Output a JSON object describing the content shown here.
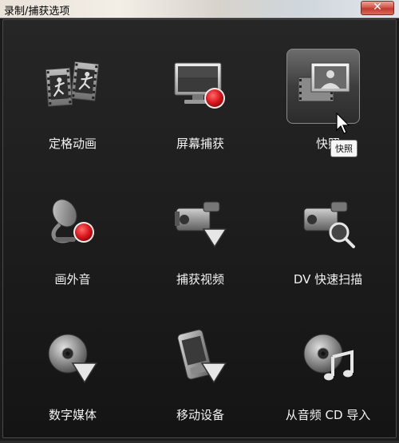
{
  "window": {
    "title": "录制/捕获选项",
    "close_label": "✕"
  },
  "tiles": [
    {
      "label": "定格动画",
      "icon": "stop-motion-icon"
    },
    {
      "label": "屏幕捕获",
      "icon": "screen-capture-icon"
    },
    {
      "label": "快照",
      "icon": "snapshot-icon"
    },
    {
      "label": "画外音",
      "icon": "voiceover-microphone-icon"
    },
    {
      "label": "捕获视频",
      "icon": "capture-video-camera-icon"
    },
    {
      "label": "DV 快速扫描",
      "icon": "dv-quick-scan-icon"
    },
    {
      "label": "数字媒体",
      "icon": "digital-media-disc-icon"
    },
    {
      "label": "移动设备",
      "icon": "mobile-device-icon"
    },
    {
      "label": "从音频 CD 导入",
      "icon": "import-audio-cd-icon"
    }
  ],
  "tooltip": {
    "text": "快照"
  },
  "colors": {
    "background": "#1b1b1b",
    "record_red": "#d8161c",
    "label_text": "#f2f2f2"
  }
}
